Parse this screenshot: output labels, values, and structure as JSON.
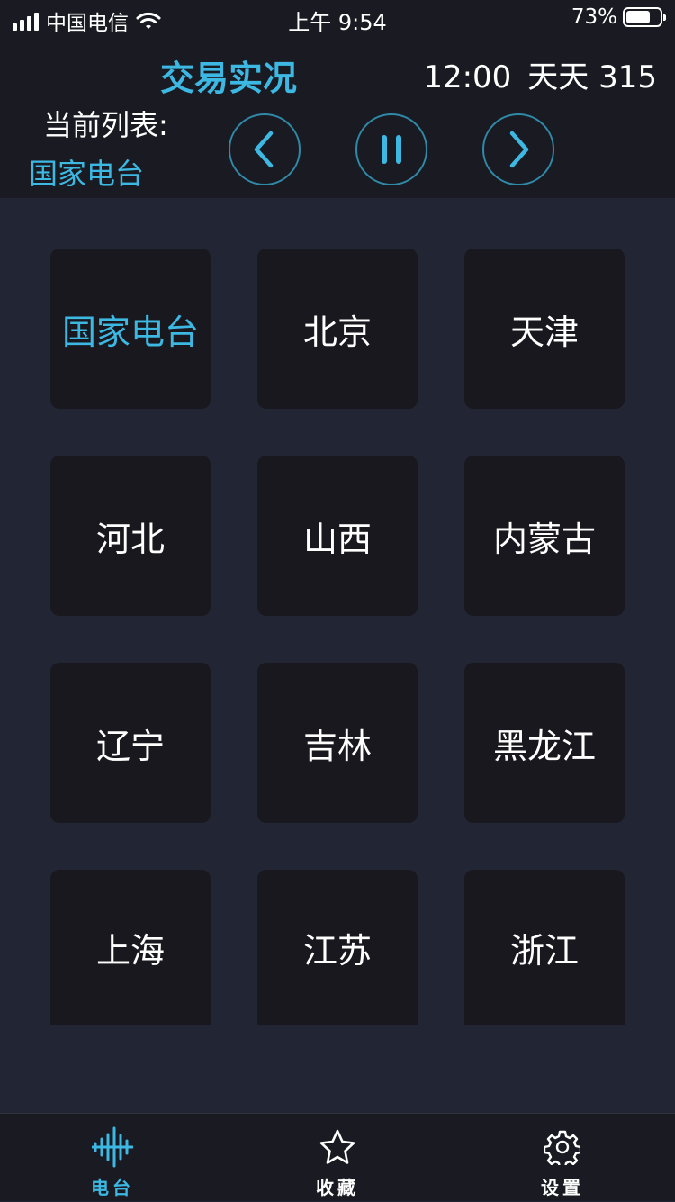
{
  "status_bar": {
    "carrier": "中国电信",
    "time": "上午 9:54",
    "battery": "73%",
    "battery_level": 0.73
  },
  "header": {
    "title": "交易实况",
    "clock": "12:00",
    "program": "天天 315",
    "current_list_label": "当前列表:",
    "current_list_value": "国家电台"
  },
  "controls": {
    "prev_icon": "chevron-left-icon",
    "pause_icon": "pause-icon",
    "next_icon": "chevron-right-icon"
  },
  "stations": [
    {
      "label": "国家电台",
      "active": true
    },
    {
      "label": "北京"
    },
    {
      "label": "天津"
    },
    {
      "label": "河北"
    },
    {
      "label": "山西"
    },
    {
      "label": "内蒙古"
    },
    {
      "label": "辽宁"
    },
    {
      "label": "吉林"
    },
    {
      "label": "黑龙江"
    },
    {
      "label": "上海"
    },
    {
      "label": "江苏"
    },
    {
      "label": "浙江"
    }
  ],
  "tabs": [
    {
      "label": "电台",
      "icon": "waveform-icon",
      "active": true
    },
    {
      "label": "收藏",
      "icon": "star-icon"
    },
    {
      "label": "设置",
      "icon": "gear-icon"
    }
  ],
  "colors": {
    "accent": "#3cb8e2",
    "background": "#222534",
    "header": "#1a1b22",
    "tile": "#18181e"
  }
}
